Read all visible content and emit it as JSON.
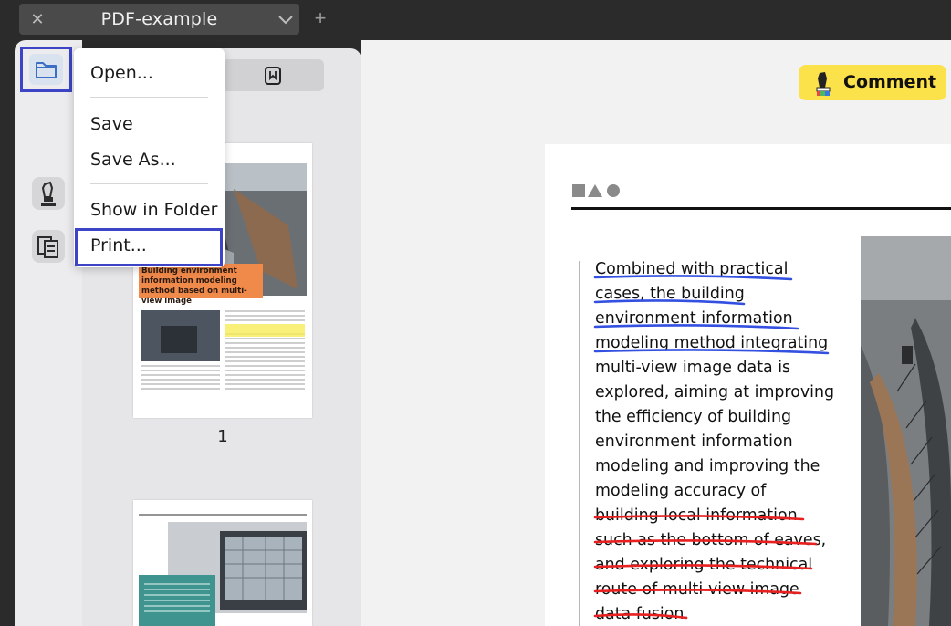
{
  "tab": {
    "title": "PDF-example",
    "close_icon": "close-icon",
    "chevron_icon": "chevron-down-icon",
    "new_tab_icon": "plus-icon"
  },
  "toolbar": {
    "comment_label": "Comment",
    "accent": "#fbe14a"
  },
  "menu": {
    "items": [
      {
        "label": "Open..."
      },
      {
        "label": "Save"
      },
      {
        "label": "Save As..."
      },
      {
        "label": "Show in Folder"
      },
      {
        "label": "Print..."
      }
    ],
    "highlight_color": "#3d45c6"
  },
  "thumbnails": {
    "page1_number": "1",
    "page1_heading": "Building environment information modeling method based on multi-view image",
    "heading_color": "#f08a4b"
  },
  "document": {
    "lines": [
      "Combined with practical",
      "cases, the building",
      "environment information",
      "modeling method integrating",
      "multi-view image data is",
      "explored, aiming at improving",
      "the efficiency of building",
      "environment information",
      "modeling and improving the",
      "modeling accuracy of",
      "building local information",
      "such as the bottom of eaves,",
      "and exploring the technical",
      "route of multi-view image",
      "data fusion."
    ],
    "underline_color": "#3350e0",
    "strike_color": "#e82020"
  }
}
